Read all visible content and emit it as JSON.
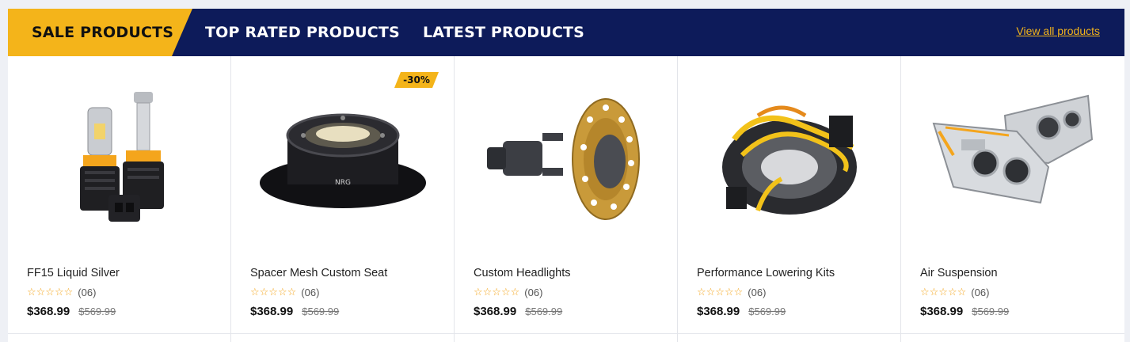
{
  "tabs": [
    {
      "label": "SALE PRODUCTS",
      "active": true
    },
    {
      "label": "TOP RATED PRODUCTS",
      "active": false
    },
    {
      "label": "LATEST PRODUCTS",
      "active": false
    }
  ],
  "view_all_label": "View all products",
  "colors": {
    "accent": "#f4b41a",
    "navy": "#0d1b5a"
  },
  "products": [
    {
      "name": "FF15 Liquid Silver",
      "rating": 0,
      "review_count": "(06)",
      "price": "$368.99",
      "old_price": "$569.99",
      "image_icon": "led-bulbs-icon"
    },
    {
      "name": "Spacer Mesh Custom Seat",
      "rating": 0,
      "review_count": "(06)",
      "price": "$368.99",
      "old_price": "$569.99",
      "badge": "-30%",
      "image_icon": "quick-release-hub-icon"
    },
    {
      "name": "Custom Headlights",
      "rating": 0,
      "review_count": "(06)",
      "price": "$368.99",
      "old_price": "$569.99",
      "image_icon": "flywheel-adapter-icon"
    },
    {
      "name": "Performance Lowering Kits",
      "rating": 0,
      "review_count": "(06)",
      "price": "$368.99",
      "old_price": "$569.99",
      "image_icon": "clock-spring-icon"
    },
    {
      "name": "Air Suspension",
      "rating": 0,
      "review_count": "(06)",
      "price": "$368.99",
      "old_price": "$569.99",
      "image_icon": "headlight-assembly-icon"
    }
  ]
}
